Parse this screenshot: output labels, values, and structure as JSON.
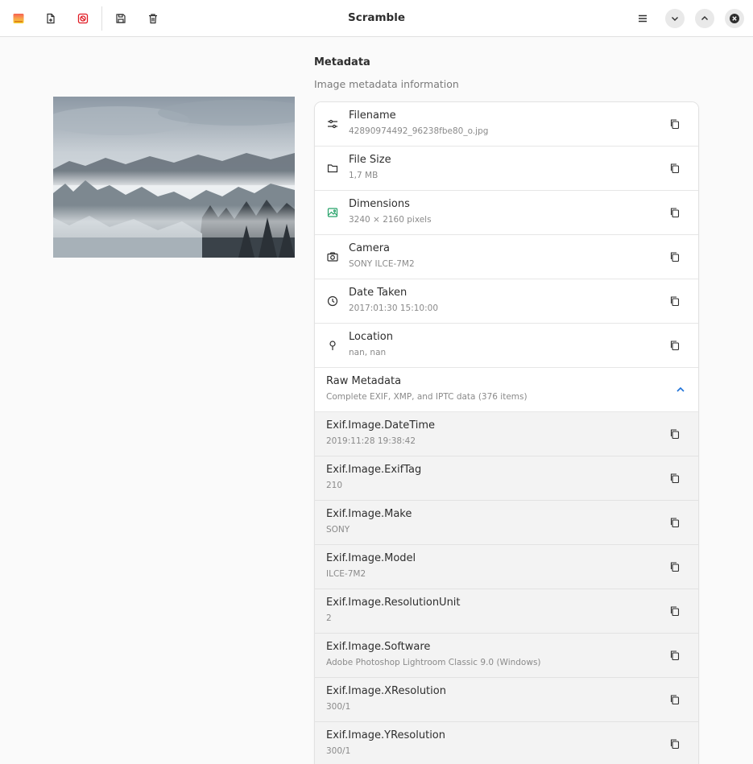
{
  "window": {
    "title": "Scramble",
    "accent_color": "#e01b24"
  },
  "toolbar": {
    "left_icons": [
      "app-logo-icon",
      "open-file-icon",
      "scramble-icon",
      "save-icon",
      "delete-icon"
    ],
    "right_icons": [
      "hamburger-menu-icon",
      "minimize-icon",
      "maximize-icon",
      "close-icon"
    ]
  },
  "metadata": {
    "title": "Metadata",
    "subtitle": "Image metadata information",
    "rows": [
      {
        "icon": "sliders-icon",
        "label": "Filename",
        "value": "42890974492_96238fbe80_o.jpg"
      },
      {
        "icon": "folder-icon",
        "label": "File Size",
        "value": "1,7 MB"
      },
      {
        "icon": "image-icon",
        "label": "Dimensions",
        "value": "3240 × 2160 pixels"
      },
      {
        "icon": "camera-icon",
        "label": "Camera",
        "value": "SONY ILCE-7M2"
      },
      {
        "icon": "clock-icon",
        "label": "Date Taken",
        "value": "2017:01:30 15:10:00"
      },
      {
        "icon": "location-pin-icon",
        "label": "Location",
        "value": "nan, nan"
      }
    ],
    "raw": {
      "title": "Raw Metadata",
      "subtitle": "Complete EXIF, XMP, and IPTC data (376 items)",
      "items": [
        {
          "label": "Exif.Image.DateTime",
          "value": "2019:11:28 19:38:42"
        },
        {
          "label": "Exif.Image.ExifTag",
          "value": "210"
        },
        {
          "label": "Exif.Image.Make",
          "value": "SONY"
        },
        {
          "label": "Exif.Image.Model",
          "value": "ILCE-7M2"
        },
        {
          "label": "Exif.Image.ResolutionUnit",
          "value": "2"
        },
        {
          "label": "Exif.Image.Software",
          "value": "Adobe Photoshop Lightroom Classic 9.0 (Windows)"
        },
        {
          "label": "Exif.Image.XResolution",
          "value": "300/1"
        },
        {
          "label": "Exif.Image.YResolution",
          "value": "300/1"
        }
      ]
    }
  }
}
